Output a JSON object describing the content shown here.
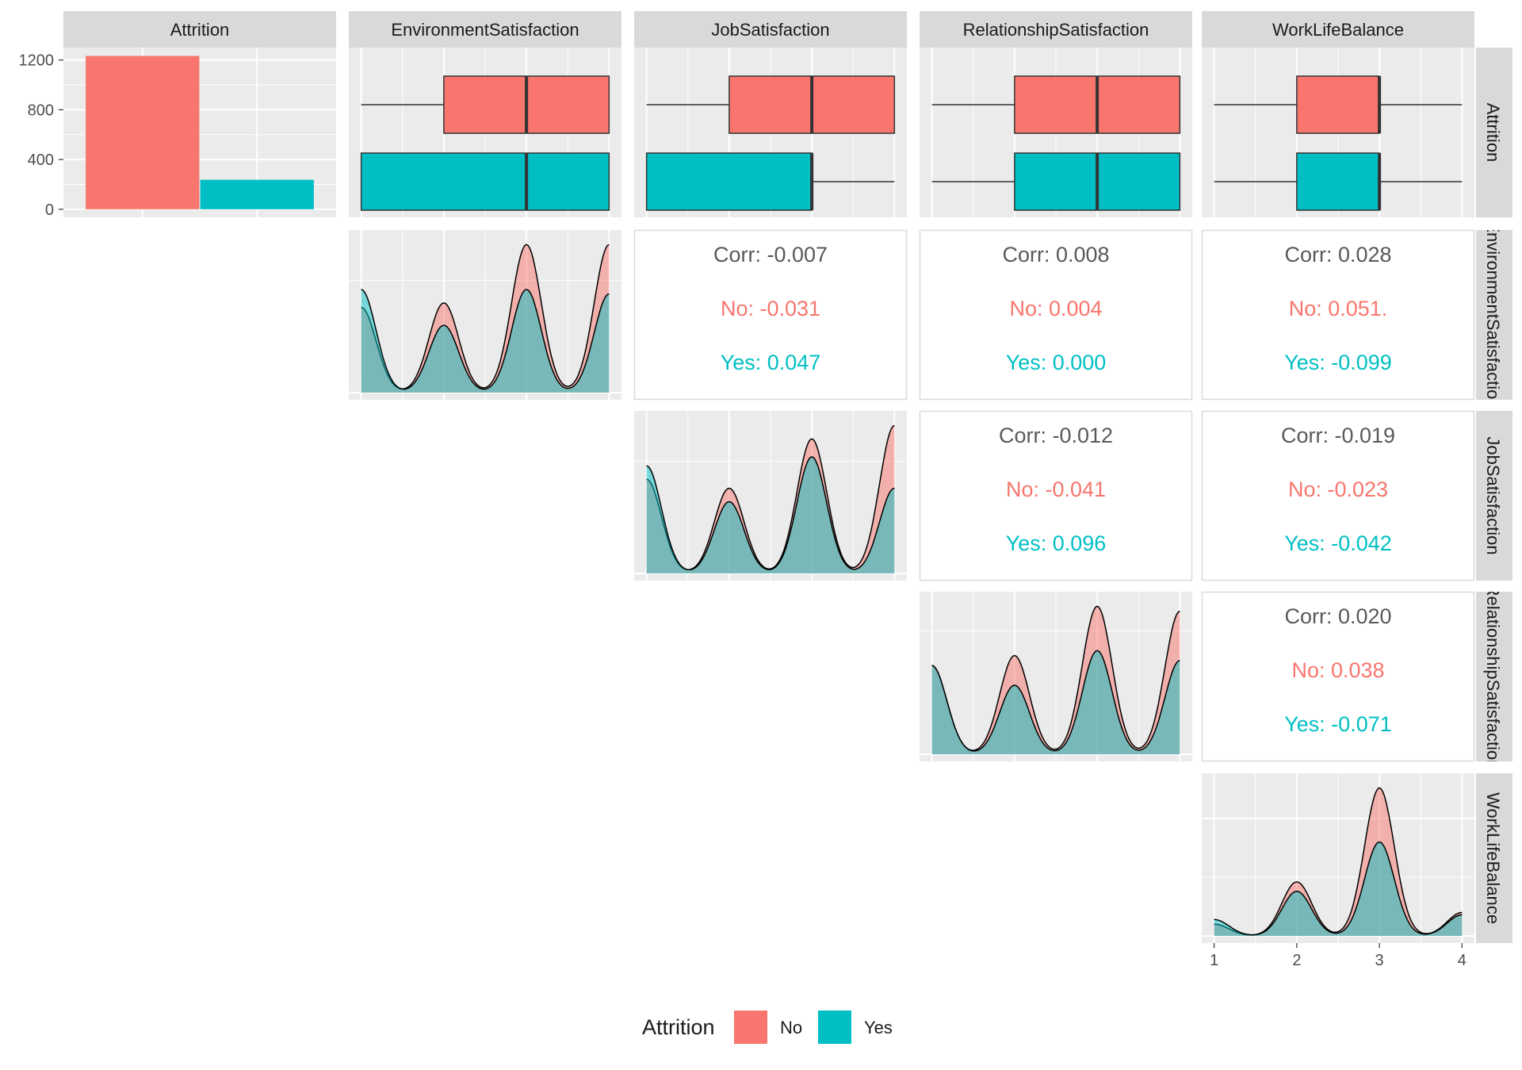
{
  "colors": {
    "no": "#F8766D",
    "yes": "#00BFC4",
    "panel_bg": "#EBEBEB",
    "strip_bg": "#D9D9D9",
    "grid": "#FFFFFF",
    "corr_text": "#595959"
  },
  "variables": [
    "Attrition",
    "EnvironmentSatisfaction",
    "JobSatisfaction",
    "RelationshipSatisfaction",
    "WorkLifeBalance"
  ],
  "chart_data": {
    "type": "pairs-matrix",
    "legend": {
      "title": "Attrition",
      "entries": [
        "No",
        "Yes"
      ],
      "placement": "bottom"
    },
    "bar": {
      "categories": [
        "No",
        "Yes"
      ],
      "values": [
        1233,
        237
      ],
      "ylim": [
        0,
        1300
      ],
      "yticks": [
        0,
        400,
        800,
        1200
      ]
    },
    "boxplots": [
      {
        "variable": "EnvironmentSatisfaction",
        "no": {
          "min": 1,
          "q1": 2,
          "median": 3,
          "q3": 4,
          "max": 4
        },
        "yes": {
          "min": 1,
          "q1": 1,
          "median": 3,
          "q3": 4,
          "max": 4
        }
      },
      {
        "variable": "JobSatisfaction",
        "no": {
          "min": 1,
          "q1": 2,
          "median": 3,
          "q3": 4,
          "max": 4
        },
        "yes": {
          "min": 1,
          "q1": 1,
          "median": 3,
          "q3": 3,
          "max": 4
        }
      },
      {
        "variable": "RelationshipSatisfaction",
        "no": {
          "min": 1,
          "q1": 2,
          "median": 3,
          "q3": 4,
          "max": 4
        },
        "yes": {
          "min": 1,
          "q1": 2,
          "median": 3,
          "q3": 4,
          "max": 4
        }
      },
      {
        "variable": "WorkLifeBalance",
        "no": {
          "min": 1,
          "q1": 2,
          "median": 3,
          "q3": 3,
          "max": 4
        },
        "yes": {
          "min": 1,
          "q1": 2,
          "median": 3,
          "q3": 3,
          "max": 4
        }
      }
    ],
    "densities": [
      {
        "variable": "EnvironmentSatisfaction",
        "x": [
          1,
          2,
          3,
          4
        ],
        "no": [
          0.19,
          0.2,
          0.33,
          0.33
        ],
        "yes": [
          0.23,
          0.15,
          0.23,
          0.22
        ]
      },
      {
        "variable": "JobSatisfaction",
        "x": [
          1,
          2,
          3,
          4
        ],
        "no": [
          0.21,
          0.19,
          0.3,
          0.33
        ],
        "yes": [
          0.24,
          0.16,
          0.26,
          0.19
        ]
      },
      {
        "variable": "RelationshipSatisfaction",
        "x": [
          1,
          2,
          3,
          4
        ],
        "no": [
          0.18,
          0.2,
          0.3,
          0.29
        ],
        "yes": [
          0.18,
          0.14,
          0.21,
          0.19
        ]
      },
      {
        "variable": "WorkLifeBalance",
        "x": [
          1,
          2,
          3,
          4
        ],
        "no": [
          0.05,
          0.23,
          0.63,
          0.1
        ],
        "yes": [
          0.07,
          0.19,
          0.4,
          0.09
        ]
      }
    ],
    "x_ticks": [
      "1",
      "2",
      "3",
      "4"
    ],
    "correlations": [
      {
        "row": "EnvironmentSatisfaction",
        "col": "JobSatisfaction",
        "corr": "Corr: -0.007",
        "no": "No: -0.031",
        "yes": "Yes: 0.047"
      },
      {
        "row": "EnvironmentSatisfaction",
        "col": "RelationshipSatisfaction",
        "corr": "Corr: 0.008",
        "no": "No: 0.004",
        "yes": "Yes: 0.000"
      },
      {
        "row": "EnvironmentSatisfaction",
        "col": "WorkLifeBalance",
        "corr": "Corr: 0.028",
        "no": "No: 0.051.",
        "yes": "Yes: -0.099"
      },
      {
        "row": "JobSatisfaction",
        "col": "RelationshipSatisfaction",
        "corr": "Corr: -0.012",
        "no": "No: -0.041",
        "yes": "Yes: 0.096"
      },
      {
        "row": "JobSatisfaction",
        "col": "WorkLifeBalance",
        "corr": "Corr: -0.019",
        "no": "No: -0.023",
        "yes": "Yes: -0.042"
      },
      {
        "row": "RelationshipSatisfaction",
        "col": "WorkLifeBalance",
        "corr": "Corr: 0.020",
        "no": "No: 0.038",
        "yes": "Yes: -0.071"
      }
    ]
  }
}
